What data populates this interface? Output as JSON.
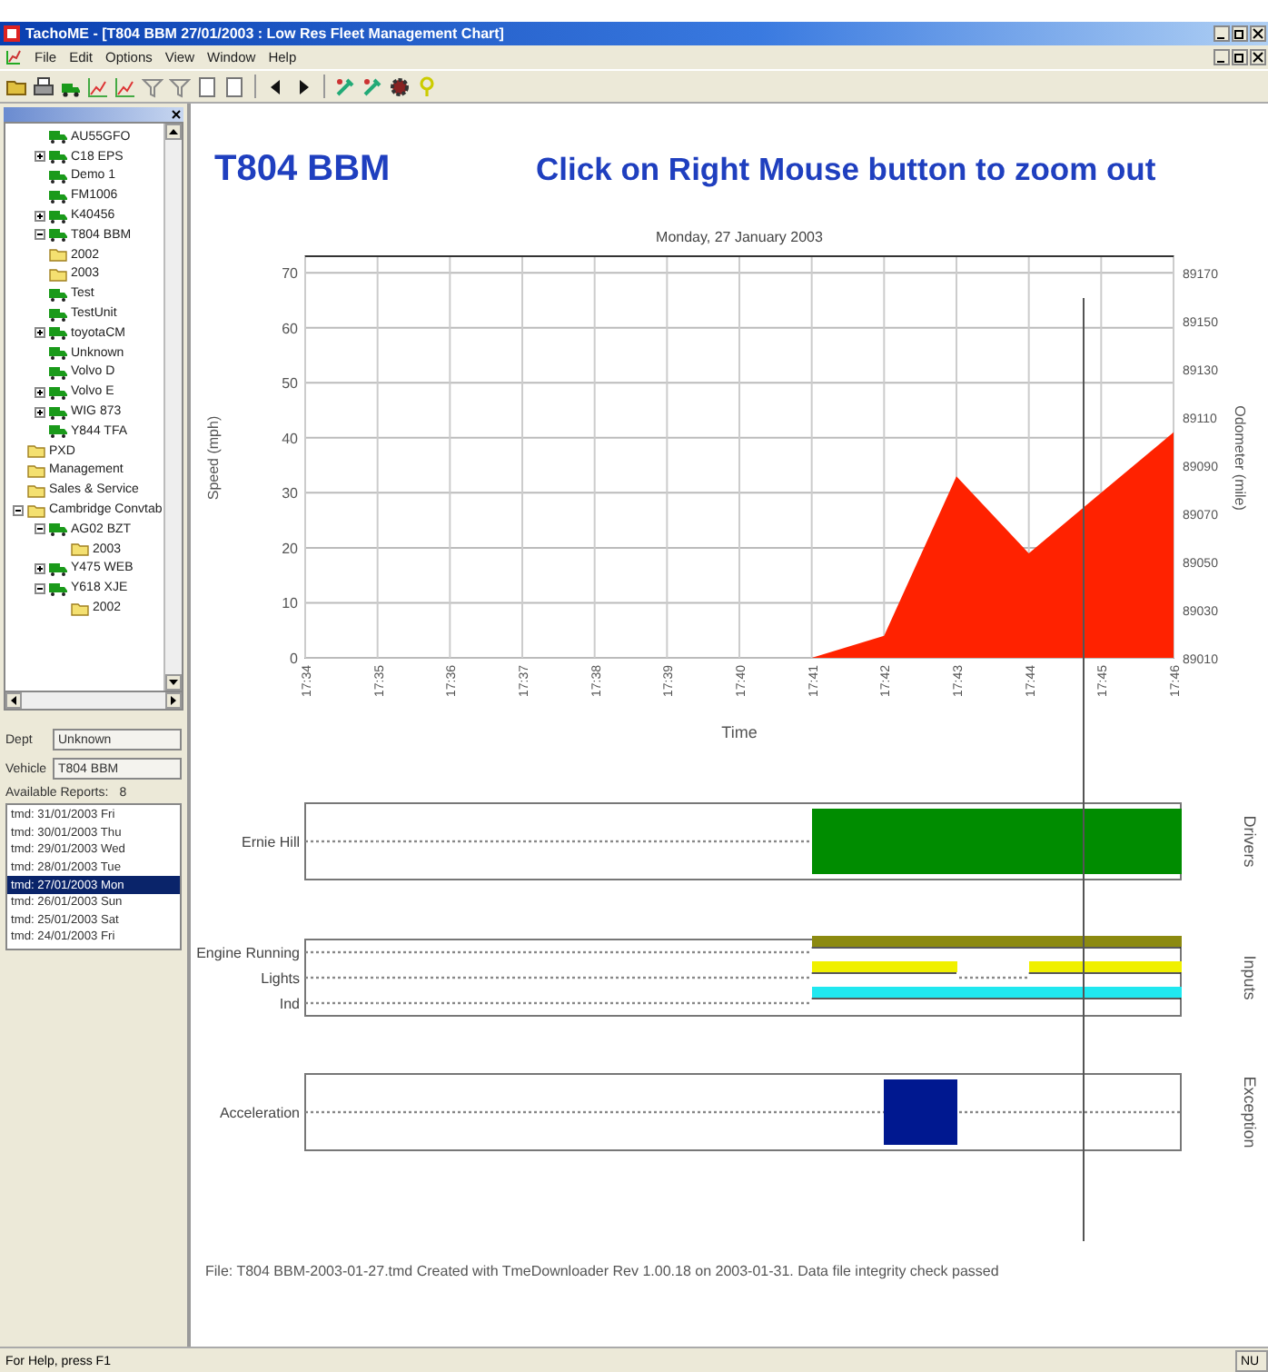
{
  "window": {
    "title": "TachoME - [T804 BBM 27/01/2003 : Low Res Fleet Management Chart]"
  },
  "menu": [
    "File",
    "Edit",
    "Options",
    "View",
    "Window",
    "Help"
  ],
  "tree": {
    "items": [
      {
        "label": "AU55GFO",
        "kind": "vehicle"
      },
      {
        "label": "C18 EPS",
        "kind": "vehicle",
        "expanded": false
      },
      {
        "label": "Demo 1",
        "kind": "vehicle"
      },
      {
        "label": "FM1006",
        "kind": "vehicle"
      },
      {
        "label": "K40456",
        "kind": "vehicle",
        "expanded": false
      },
      {
        "label": "T804 BBM",
        "kind": "vehicle",
        "expanded": true,
        "children": [
          {
            "label": "2002",
            "kind": "folder"
          },
          {
            "label": "2003",
            "kind": "folder"
          }
        ]
      },
      {
        "label": "Test",
        "kind": "vehicle"
      },
      {
        "label": "TestUnit",
        "kind": "vehicle"
      },
      {
        "label": "toyotaCM",
        "kind": "vehicle",
        "expanded": false
      },
      {
        "label": "Unknown",
        "kind": "vehicle"
      },
      {
        "label": "Volvo D",
        "kind": "vehicle"
      },
      {
        "label": "Volvo E",
        "kind": "vehicle",
        "expanded": false
      },
      {
        "label": "WIG 873",
        "kind": "vehicle",
        "expanded": false
      },
      {
        "label": "Y844 TFA",
        "kind": "vehicle"
      },
      {
        "label": "PXD",
        "kind": "folder"
      },
      {
        "label": "Management",
        "kind": "folder"
      },
      {
        "label": "Sales & Service",
        "kind": "folder"
      },
      {
        "label": "Cambridge Convtab",
        "kind": "folder",
        "expanded": true,
        "children": [
          {
            "label": "AG02 BZT",
            "kind": "vehicle",
            "expanded": true,
            "children": [
              {
                "label": "2003",
                "kind": "folder"
              }
            ]
          },
          {
            "label": "Y475 WEB",
            "kind": "vehicle",
            "expanded": false
          },
          {
            "label": "Y618 XJE",
            "kind": "vehicle",
            "expanded": true,
            "children": [
              {
                "label": "2002",
                "kind": "folder"
              }
            ]
          }
        ]
      }
    ]
  },
  "details": {
    "dept_label": "Dept",
    "dept": "Unknown",
    "vehicle_label": "Vehicle",
    "vehicle": "T804 BBM",
    "reports_label": "Available Reports:",
    "reports_count": "8"
  },
  "reports": [
    {
      "label": "tmd: 31/01/2003 Fri",
      "selected": false
    },
    {
      "label": "tmd: 30/01/2003 Thu",
      "selected": false
    },
    {
      "label": "tmd: 29/01/2003 Wed",
      "selected": false
    },
    {
      "label": "tmd: 28/01/2003 Tue",
      "selected": false
    },
    {
      "label": "tmd: 27/01/2003 Mon",
      "selected": true
    },
    {
      "label": "tmd: 26/01/2003 Sun",
      "selected": false
    },
    {
      "label": "tmd: 25/01/2003 Sat",
      "selected": false
    },
    {
      "label": "tmd: 24/01/2003 Fri",
      "selected": false
    }
  ],
  "heading": {
    "vehicle": "T804 BBM",
    "hint": "Click on Right Mouse button to zoom out"
  },
  "chart_data": {
    "type": "area",
    "title": "Monday, 27 January 2003",
    "xlabel": "Time",
    "ylabel": "Speed (mph)",
    "y2label": "Odometer (mile)",
    "categories": [
      "17:34",
      "17:35",
      "17:36",
      "17:37",
      "17:38",
      "17:39",
      "17:40",
      "17:41",
      "17:42",
      "17:43",
      "17:44",
      "17:45",
      "17:46"
    ],
    "series": [
      {
        "color": "#ff2200",
        "values": [
          null,
          null,
          null,
          null,
          null,
          null,
          null,
          0,
          4,
          33,
          19,
          30,
          41
        ]
      }
    ],
    "grid": true,
    "ylim": [
      0,
      73
    ],
    "yticks": [
      0,
      10,
      20,
      30,
      40,
      50,
      60,
      70
    ],
    "y2ticks": [
      "89010",
      "89030",
      "89050",
      "89070",
      "89090",
      "89110",
      "89130",
      "89150",
      "89170"
    ]
  },
  "timelines": [
    {
      "title": "Drivers",
      "rows": [
        {
          "label": "Ernie Hill",
          "color": "#008c00",
          "active": [
            false,
            false,
            false,
            false,
            false,
            false,
            false,
            true,
            true,
            true,
            true,
            true
          ]
        }
      ]
    },
    {
      "title": "Inputs",
      "rows": [
        {
          "label": "Engine Running",
          "color": "#8c8a10",
          "active": [
            false,
            false,
            false,
            false,
            false,
            false,
            false,
            true,
            true,
            true,
            true,
            true
          ]
        },
        {
          "label": "Lights",
          "color": "#f0f000",
          "active": [
            false,
            false,
            false,
            false,
            false,
            false,
            false,
            true,
            true,
            false,
            true,
            true
          ]
        },
        {
          "label": "Ind",
          "color": "#20e8f0",
          "active": [
            false,
            false,
            false,
            false,
            false,
            false,
            false,
            true,
            true,
            true,
            true,
            true
          ]
        }
      ]
    },
    {
      "title": "Exception",
      "rows": [
        {
          "label": "Acceleration",
          "color": "#001890",
          "active": [
            false,
            false,
            false,
            false,
            false,
            false,
            false,
            false,
            true,
            false,
            false,
            false
          ]
        }
      ]
    }
  ],
  "footer": "File: T804 BBM-2003-01-27.tmd  Created with TmeDownloader Rev 1.00.18 on 2003-01-31. Data file integrity check passed",
  "status_bar": {
    "help": "For Help, press F1",
    "num": "NU"
  }
}
